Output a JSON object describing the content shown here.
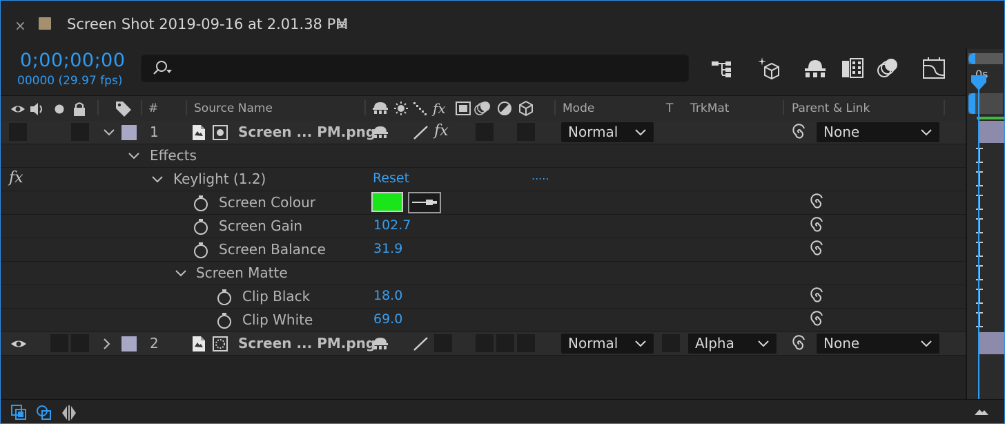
{
  "tab": {
    "close": "×",
    "title": "Screen Shot 2019-09-16 at 2.01.38 PM",
    "menu": "≡"
  },
  "time": {
    "timecode": "0;00;00;00",
    "frames": "00000 (29.97 fps)"
  },
  "search": {
    "placeholder": "",
    "value": ""
  },
  "timeline": {
    "ruler_label": "0s"
  },
  "columns": {
    "number": "#",
    "source_name": "Source Name",
    "mode": "Mode",
    "t": "T",
    "trkmat": "TrkMat",
    "parent_link": "Parent & Link"
  },
  "layers": [
    {
      "number": "1",
      "name": "Screen ... PM.png",
      "mode": "Normal",
      "trkmat": "",
      "parent": "None"
    },
    {
      "number": "2",
      "name": "Screen ... PM.png",
      "mode": "Normal",
      "trkmat": "Alpha",
      "parent": "None"
    }
  ],
  "effects": {
    "group_label": "Effects",
    "fx_badge": "fx",
    "effect_name": "Keylight (1.2)",
    "reset": "Reset",
    "about": ".....",
    "screen_colour_label": "Screen Colour",
    "screen_colour": "#19e619",
    "screen_gain_label": "Screen Gain",
    "screen_gain": "102.7",
    "screen_balance_label": "Screen Balance",
    "screen_balance": "31.9",
    "screen_matte_label": "Screen Matte",
    "clip_black_label": "Clip Black",
    "clip_black": "18.0",
    "clip_white_label": "Clip White",
    "clip_white": "69.0"
  },
  "colors": {
    "accent": "#2f9bf3",
    "label_color": "#a8a8c6"
  }
}
